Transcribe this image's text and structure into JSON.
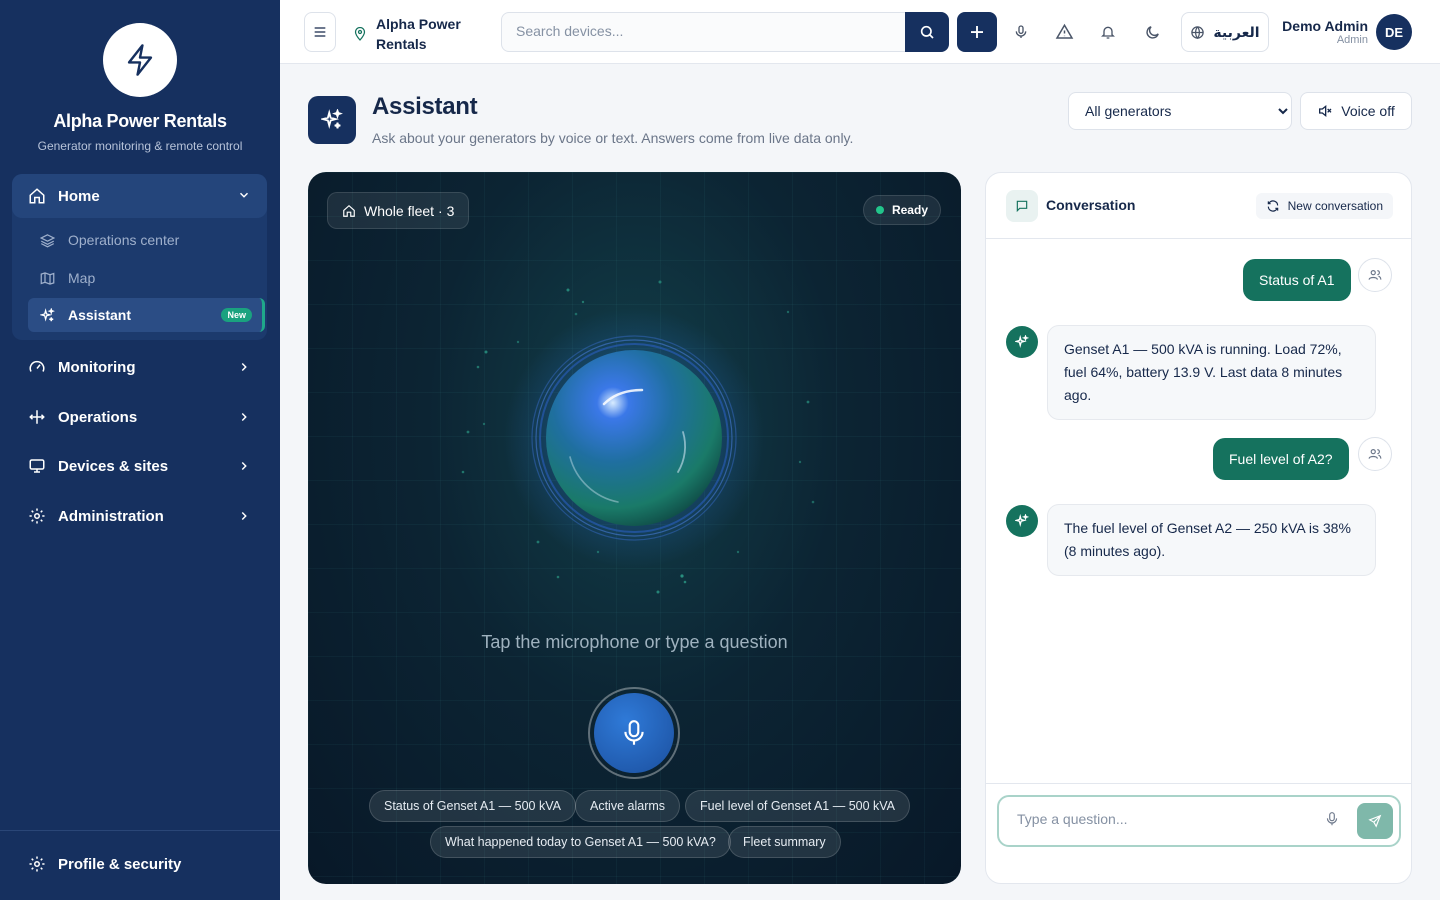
{
  "app": {
    "name": "Alpha Power Rentals",
    "subtitle": "Generator monitoring & remote control"
  },
  "sidebar": {
    "home": {
      "label": "Home",
      "children": [
        {
          "label": "Operations center",
          "icon": "layers-icon"
        },
        {
          "label": "Map",
          "icon": "map-icon"
        },
        {
          "label": "Assistant",
          "icon": "sparkles-icon",
          "badge": "New",
          "active": true
        }
      ]
    },
    "items": [
      {
        "label": "Monitoring",
        "icon": "gauge-icon"
      },
      {
        "label": "Operations",
        "icon": "move-icon"
      },
      {
        "label": "Devices & sites",
        "icon": "monitor-icon"
      },
      {
        "label": "Administration",
        "icon": "gear-icon"
      }
    ],
    "footer": {
      "label": "Profile & security",
      "icon": "gear-icon"
    }
  },
  "topbar": {
    "location": "Alpha Power Rentals",
    "search_placeholder": "Search devices...",
    "language": "العربية",
    "user_name": "Demo Admin",
    "user_role": "Admin",
    "avatar_initials": "DE"
  },
  "page": {
    "title": "Assistant",
    "subtitle": "Ask about your generators by voice or text. Answers come from live data only.",
    "generator_filter": "All generators",
    "voice_toggle": "Voice off"
  },
  "stage": {
    "fleet_label": "Whole fleet",
    "fleet_count": "· 3",
    "status": "Ready",
    "prompt": "Tap the microphone or type a question",
    "suggestions_row1": [
      "Status of Genset A1 — 500 kVA",
      "Active alarms",
      "Fuel level of Genset A1 — 500 kVA"
    ],
    "suggestions_row2": [
      "What happened today to Genset A1 — 500 kVA?",
      "Fleet summary"
    ]
  },
  "conversation": {
    "title": "Conversation",
    "new_label": "New conversation",
    "messages": [
      {
        "role": "user",
        "text": "Status of A1"
      },
      {
        "role": "assistant",
        "text": "Genset A1 — 500 kVA is running. Load 72%, fuel 64%, battery 13.9 V. Last data 8 minutes ago."
      },
      {
        "role": "user",
        "text": "Fuel level of A2?"
      },
      {
        "role": "assistant",
        "text": "The fuel level of Genset A2 — 250 kVA is 38% (8 minutes ago)."
      }
    ],
    "input_placeholder": "Type a question..."
  },
  "colors": {
    "navy": "#16305f",
    "accent_green": "#15725e",
    "status_green": "#22c58b"
  }
}
